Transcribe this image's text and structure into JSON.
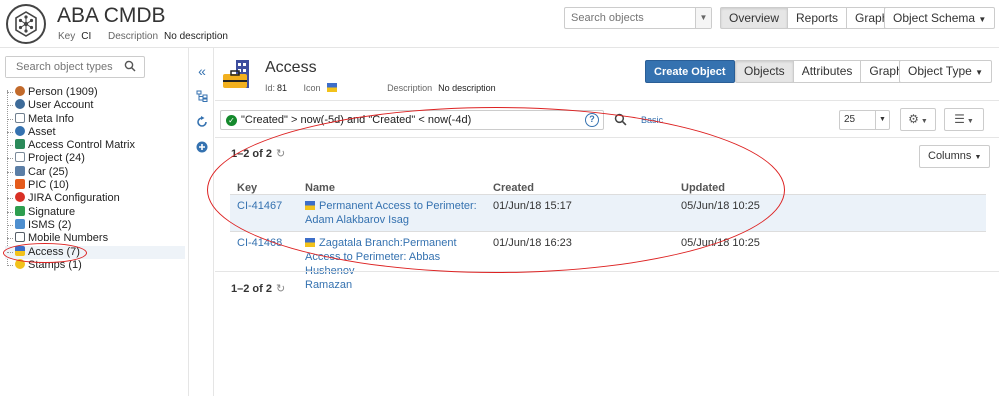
{
  "app": {
    "title": "ABA CMDB",
    "key_label": "Key",
    "key_value": "CI",
    "description_label": "Description",
    "description_value": "No description"
  },
  "header": {
    "search_placeholder": "Search objects",
    "nav": [
      "Overview",
      "Reports",
      "Graph"
    ],
    "nav_active": "Overview",
    "schema_menu": "Object Schema"
  },
  "sidebar": {
    "search_placeholder": "Search object types",
    "items": [
      {
        "label": "Person (1909)",
        "icon": "person-icon",
        "color": "#c26a2b"
      },
      {
        "label": "User Account",
        "icon": "user-account-icon",
        "color": "#3d6b99"
      },
      {
        "label": "Meta Info",
        "icon": "meta-info-icon",
        "color": "#6f7f8f"
      },
      {
        "label": "Asset",
        "icon": "asset-icon",
        "color": "#3572b0"
      },
      {
        "label": "Access Control Matrix",
        "icon": "matrix-icon",
        "color": "#2b8a5a"
      },
      {
        "label": "Project (24)",
        "icon": "project-icon",
        "color": "#7a8a9a"
      },
      {
        "label": "Car (25)",
        "icon": "car-icon",
        "color": "#5b7ea6"
      },
      {
        "label": "PIC (10)",
        "icon": "pic-icon",
        "color": "#e55b1b"
      },
      {
        "label": "JIRA Configuration",
        "icon": "jira-config-icon",
        "color": "#d93025"
      },
      {
        "label": "Signature",
        "icon": "signature-icon",
        "color": "#2e9e4f"
      },
      {
        "label": "ISMS (2)",
        "icon": "isms-icon",
        "color": "#4e8fcf"
      },
      {
        "label": "Mobile Numbers",
        "icon": "mobile-icon",
        "color": "#555e68"
      },
      {
        "label": "Access (7)",
        "icon": "access-icon",
        "color": "#3d6ec9"
      },
      {
        "label": "Stamps (1)",
        "icon": "stamp-icon",
        "color": "#f2c21b"
      }
    ]
  },
  "object_type": {
    "name": "Access",
    "id_label": "Id:",
    "id_value": "81",
    "icon_label": "Icon",
    "description_label": "Description",
    "description_value": "No description",
    "create_button": "Create Object",
    "tabs": [
      "Objects",
      "Attributes",
      "Graph"
    ],
    "tabs_active": "Objects",
    "type_menu": "Object Type"
  },
  "query": {
    "text": "\"Created\" > now(-5d) and \"Created\" < now(-4d)",
    "basic_link": "Basic",
    "per_page": "25"
  },
  "results": {
    "pager_prefix": "1–2 of",
    "pager_total": "2",
    "columns_button": "Columns",
    "headers": [
      "Key",
      "Name",
      "Created",
      "Updated"
    ],
    "rows": [
      {
        "key": "CI-41467",
        "name_line1": "Permanent Access to Perimeter:",
        "name_line2": "Adam Alakbarov Isag",
        "name_line3": "",
        "created": "01/Jun/18 15:17",
        "updated": "05/Jun/18 10:25"
      },
      {
        "key": "CI-41468",
        "name_line1": "Zagatala Branch:Permanent",
        "name_line2": "Access to Perimeter: Abbas Hushenov",
        "name_line3": "Ramazan",
        "created": "01/Jun/18 16:23",
        "updated": "05/Jun/18 10:25"
      }
    ]
  },
  "colors": {
    "primary": "#3572b0",
    "annotation": "#dd2222",
    "success": "#14892c"
  }
}
